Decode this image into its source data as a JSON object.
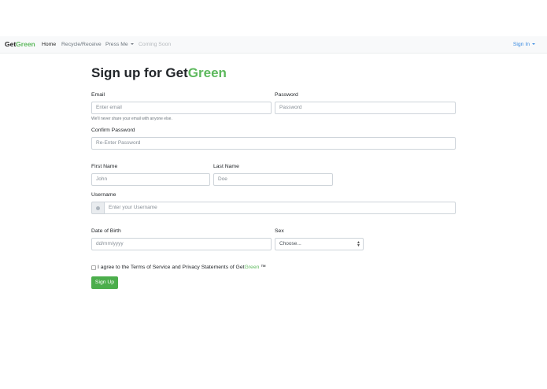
{
  "navbar": {
    "brand_part1": "Get",
    "brand_part2": "Green",
    "items": [
      {
        "label": "Home"
      },
      {
        "label": "Recycle/Receive"
      },
      {
        "label": "Press Me"
      },
      {
        "label": "Coming Soon"
      }
    ],
    "signin_label": "Sign In"
  },
  "form": {
    "title_part1": "Sign up for Get",
    "title_part2": "Green",
    "email_label": "Email",
    "email_placeholder": "Enter email",
    "email_help": "We'll never share your email with anyone else.",
    "password_label": "Password",
    "password_placeholder": "Password",
    "confirm_label": "Confirm Password",
    "confirm_placeholder": "Re-Enter Password",
    "first_name_label": "First Name",
    "first_name_placeholder": "John",
    "last_name_label": "Last Name",
    "last_name_placeholder": "Doe",
    "username_label": "Username",
    "username_placeholder": "Enter your Username",
    "dob_label": "Date of Birth",
    "dob_placeholder": "dd/mm/yyyy",
    "sex_label": "Sex",
    "sex_selected": "Choose...",
    "agree_text": "I agree to the Terms of Service and Privacy Statements of Get",
    "agree_brand": "Green",
    "agree_tm": " ™",
    "signup_button": "Sign Up"
  },
  "colors": {
    "brand_green": "#5cb85c",
    "button_green": "#4cae4c",
    "link_blue": "#3a8be0"
  }
}
